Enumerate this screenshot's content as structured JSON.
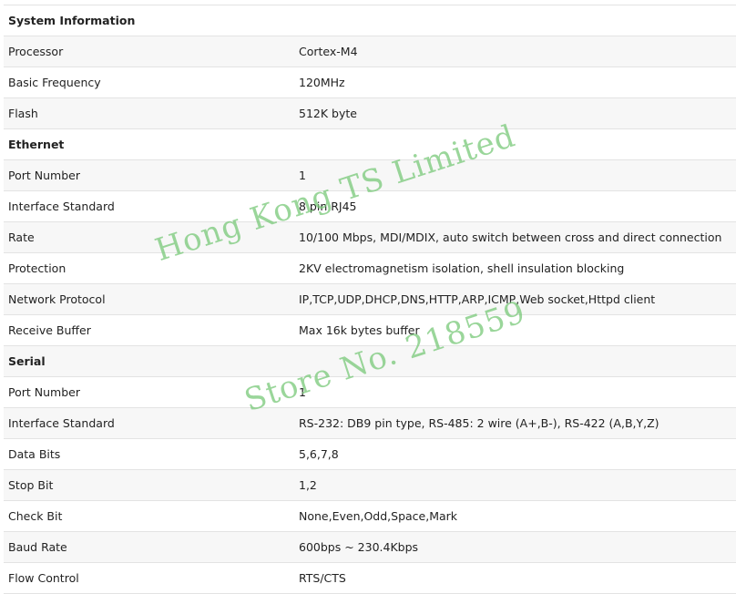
{
  "sections": [
    {
      "title": "System Information",
      "rows": [
        {
          "label": "Processor",
          "value": "Cortex-M4"
        },
        {
          "label": "Basic Frequency",
          "value": "120MHz"
        },
        {
          "label": "Flash",
          "value": "512K byte"
        }
      ]
    },
    {
      "title": "Ethernet",
      "rows": [
        {
          "label": "Port Number",
          "value": "1"
        },
        {
          "label": "Interface Standard",
          "value": "8 pin RJ45"
        },
        {
          "label": "Rate",
          "value": "10/100 Mbps, MDI/MDIX, auto switch between cross and direct connection"
        },
        {
          "label": "Protection",
          "value": "2KV electromagnetism isolation, shell insulation blocking"
        },
        {
          "label": "Network Protocol",
          "value": "IP,TCP,UDP,DHCP,DNS,HTTP,ARP,ICMP,Web socket,Httpd client"
        },
        {
          "label": "Receive Buffer",
          "value": "Max 16k bytes buffer"
        }
      ]
    },
    {
      "title": "Serial",
      "rows": [
        {
          "label": "Port Number",
          "value": "1"
        },
        {
          "label": "Interface Standard",
          "value": "RS-232: DB9 pin type, RS-485: 2 wire (A+,B-), RS-422 (A,B,Y,Z)"
        },
        {
          "label": "Data Bits",
          "value": "5,6,7,8"
        },
        {
          "label": "Stop Bit",
          "value": "1,2"
        },
        {
          "label": "Check Bit",
          "value": "None,Even,Odd,Space,Mark"
        },
        {
          "label": "Baud Rate",
          "value": "600bps ~ 230.4Kbps"
        },
        {
          "label": "Flow Control",
          "value": "RTS/CTS"
        }
      ]
    }
  ],
  "watermark": {
    "line1": "Hong Kong TS Limited",
    "line2": "Store No. 218559",
    "color": "#78c878"
  }
}
